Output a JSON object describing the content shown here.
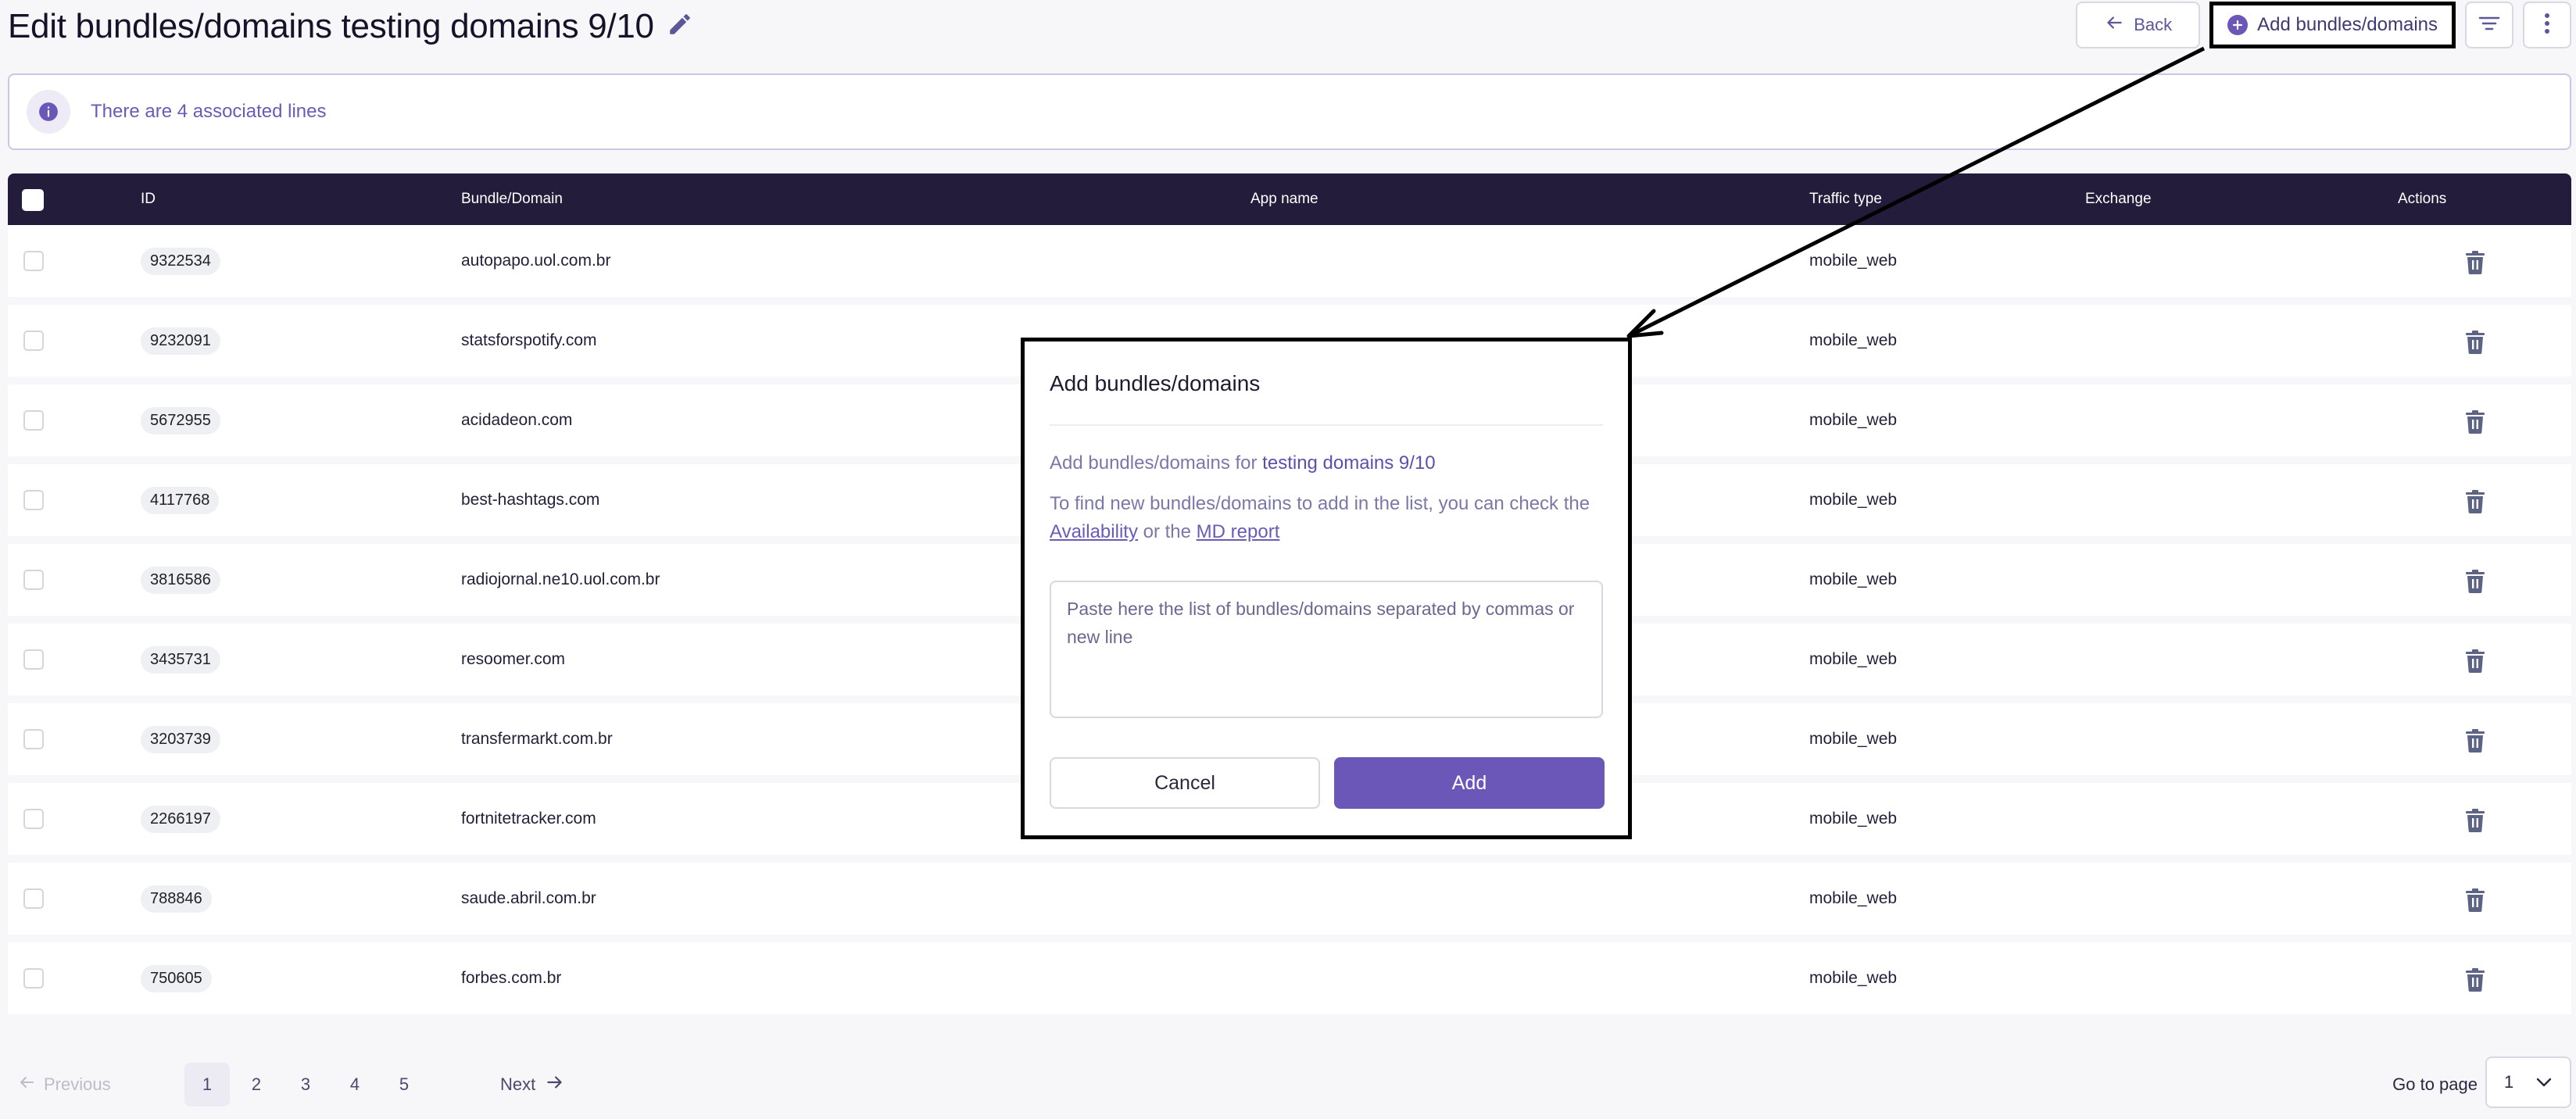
{
  "header": {
    "title": "Edit bundles/domains testing domains 9/10",
    "back_label": "Back",
    "add_label": "Add bundles/domains"
  },
  "info": {
    "text": "There are 4 associated lines"
  },
  "table": {
    "columns": [
      "ID",
      "Bundle/Domain",
      "App name",
      "Traffic type",
      "Exchange",
      "Actions"
    ],
    "rows": [
      {
        "id": "9322534",
        "domain": "autopapo.uol.com.br",
        "app": "",
        "traffic": "mobile_web",
        "exchange": ""
      },
      {
        "id": "9232091",
        "domain": "statsforspotify.com",
        "app": "",
        "traffic": "mobile_web",
        "exchange": ""
      },
      {
        "id": "5672955",
        "domain": "acidadeon.com",
        "app": "",
        "traffic": "mobile_web",
        "exchange": ""
      },
      {
        "id": "4117768",
        "domain": "best-hashtags.com",
        "app": "",
        "traffic": "mobile_web",
        "exchange": ""
      },
      {
        "id": "3816586",
        "domain": "radiojornal.ne10.uol.com.br",
        "app": "",
        "traffic": "mobile_web",
        "exchange": ""
      },
      {
        "id": "3435731",
        "domain": "resoomer.com",
        "app": "",
        "traffic": "mobile_web",
        "exchange": ""
      },
      {
        "id": "3203739",
        "domain": "transfermarkt.com.br",
        "app": "",
        "traffic": "mobile_web",
        "exchange": ""
      },
      {
        "id": "2266197",
        "domain": "fortnitetracker.com",
        "app": "",
        "traffic": "mobile_web",
        "exchange": ""
      },
      {
        "id": "788846",
        "domain": "saude.abril.com.br",
        "app": "",
        "traffic": "mobile_web",
        "exchange": ""
      },
      {
        "id": "750605",
        "domain": "forbes.com.br",
        "app": "",
        "traffic": "mobile_web",
        "exchange": ""
      }
    ]
  },
  "pagination": {
    "previous": "Previous",
    "next": "Next",
    "pages": [
      "1",
      "2",
      "3",
      "4",
      "5"
    ],
    "current": "1",
    "goto_label": "Go to page",
    "goto_value": "1"
  },
  "modal": {
    "title": "Add bundles/domains",
    "intro": "Add bundles/domains for",
    "list_name": "testing domains 9/10",
    "help_prefix": "To find new bundles/domains to add in the list, you can check the",
    "link_availability": "Availability",
    "help_or": "or the",
    "link_md": "MD report",
    "placeholder": "Paste here the list of bundles/domains separated by commas or new line",
    "cancel_label": "Cancel",
    "add_label": "Add"
  },
  "colors": {
    "accent": "#6a57b8",
    "header_bg": "#231d3b",
    "info_text": "#6a5bb8"
  }
}
